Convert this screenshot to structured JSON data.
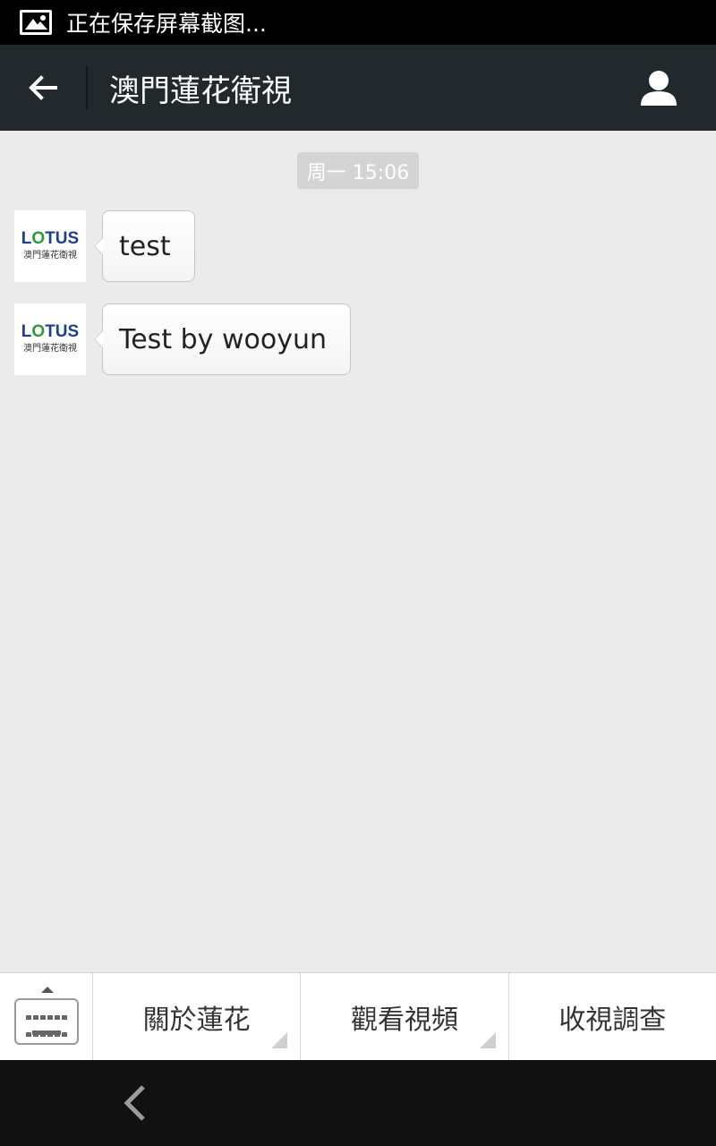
{
  "status_bar": {
    "icon": "image-icon",
    "text": "正在保存屏幕截图..."
  },
  "header": {
    "back_icon": "arrow-left-icon",
    "title": "澳門蓮花衛視",
    "profile_icon": "person-icon"
  },
  "chat": {
    "timestamp": "周一 15:06",
    "messages": [
      {
        "avatar": {
          "logo_text": "LOTUS",
          "logo_sub": "澳門蓮花衛視"
        },
        "text": "test"
      },
      {
        "avatar": {
          "logo_text": "LOTUS",
          "logo_sub": "澳門蓮花衛視"
        },
        "text": "Test by wooyun"
      }
    ]
  },
  "menu": {
    "keyboard_icon": "keyboard-icon",
    "items": [
      {
        "label": "關於蓮花",
        "has_submenu": true
      },
      {
        "label": "觀看視頻",
        "has_submenu": true
      },
      {
        "label": "收視調查",
        "has_submenu": false
      }
    ]
  },
  "nav_bar": {
    "back_icon": "chevron-left-icon"
  },
  "colors": {
    "header_bg": "#22292c",
    "chat_bg": "#ebebeb",
    "logo_blue": "#1c3f8e",
    "logo_green": "#2f9a3a"
  }
}
